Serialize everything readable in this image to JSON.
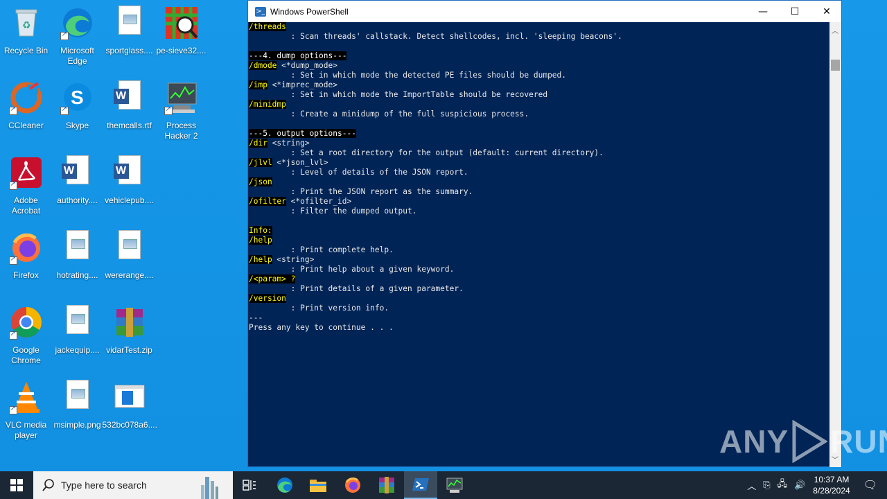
{
  "desktop": {
    "icons": [
      {
        "label": "Recycle Bin",
        "icon": "recycle-bin-icon"
      },
      {
        "label": "Microsoft Edge",
        "icon": "edge-icon"
      },
      {
        "label": "sportglass....",
        "icon": "image-file-icon"
      },
      {
        "label": "pe-sieve32....",
        "icon": "pe-sieve-icon"
      },
      {
        "label": "CCleaner",
        "icon": "ccleaner-icon"
      },
      {
        "label": "Skype",
        "icon": "skype-icon"
      },
      {
        "label": "themcalls.rtf",
        "icon": "word-doc-icon"
      },
      {
        "label": "Process Hacker 2",
        "icon": "process-hacker-icon"
      },
      {
        "label": "Adobe Acrobat",
        "icon": "acrobat-icon"
      },
      {
        "label": "authority....",
        "icon": "word-doc-icon"
      },
      {
        "label": "vehiclepub....",
        "icon": "word-doc-icon"
      },
      {
        "label": "Firefox",
        "icon": "firefox-icon"
      },
      {
        "label": "hotrating....",
        "icon": "image-file-icon"
      },
      {
        "label": "wererange....",
        "icon": "image-file-icon"
      },
      {
        "label": "Google Chrome",
        "icon": "chrome-icon"
      },
      {
        "label": "jackequip....",
        "icon": "image-file-icon"
      },
      {
        "label": "vidarTest.zip",
        "icon": "winrar-archive-icon"
      },
      {
        "label": "VLC media player",
        "icon": "vlc-icon"
      },
      {
        "label": "msimple.png",
        "icon": "image-file-icon"
      },
      {
        "label": "532bc078a6....",
        "icon": "generic-file-icon"
      }
    ]
  },
  "window": {
    "title": "Windows PowerShell",
    "minimize": "—",
    "maximize": "☐",
    "close": "✕"
  },
  "console": {
    "lines": [
      {
        "h": "/threads",
        "t": ""
      },
      {
        "h": "",
        "t": "         : Scan threads' callstack. Detect shellcodes, incl. 'sleeping beacons'."
      },
      {
        "h": "",
        "t": ""
      },
      {
        "h": "---4. dump options---",
        "t": "",
        "w": true
      },
      {
        "h": "/dmode",
        "t": " <*dump_mode>"
      },
      {
        "h": "",
        "t": "         : Set in which mode the detected PE files should be dumped."
      },
      {
        "h": "/imp",
        "t": " <*imprec_mode>"
      },
      {
        "h": "",
        "t": "         : Set in which mode the ImportTable should be recovered"
      },
      {
        "h": "/minidmp",
        "t": ""
      },
      {
        "h": "",
        "t": "         : Create a minidump of the full suspicious process."
      },
      {
        "h": "",
        "t": ""
      },
      {
        "h": "---5. output options---",
        "t": "",
        "w": true
      },
      {
        "h": "/dir",
        "t": " <string>"
      },
      {
        "h": "",
        "t": "         : Set a root directory for the output (default: current directory)."
      },
      {
        "h": "/jlvl",
        "t": " <*json_lvl>"
      },
      {
        "h": "",
        "t": "         : Level of details of the JSON report."
      },
      {
        "h": "/json",
        "t": ""
      },
      {
        "h": "",
        "t": "         : Print the JSON report as the summary."
      },
      {
        "h": "/ofilter",
        "t": " <*ofilter_id>"
      },
      {
        "h": "",
        "t": "         : Filter the dumped output."
      },
      {
        "h": "",
        "t": ""
      },
      {
        "h": "Info:",
        "t": ""
      },
      {
        "h": "/help",
        "t": ""
      },
      {
        "h": "",
        "t": "         : Print complete help."
      },
      {
        "h": "/help",
        "t": " <string>"
      },
      {
        "h": "",
        "t": "         : Print help about a given keyword."
      },
      {
        "h": "/<param> ?",
        "t": ""
      },
      {
        "h": "",
        "t": "         : Print details of a given parameter."
      },
      {
        "h": "/version",
        "t": ""
      },
      {
        "h": "",
        "t": "         : Print version info."
      },
      {
        "h": "",
        "t": "---"
      },
      {
        "h": "",
        "t": "Press any key to continue . . ."
      }
    ]
  },
  "watermark": {
    "text": "ANY",
    "text2": "RUN"
  },
  "taskbar": {
    "search_placeholder": "Type here to search",
    "apps": [
      "task-view-icon",
      "edge-icon",
      "file-explorer-icon",
      "firefox-icon",
      "winrar-icon",
      "powershell-icon",
      "process-hacker-icon"
    ],
    "time": "10:37 AM",
    "date": "8/28/2024"
  },
  "colors": {
    "console_bg": "#012456",
    "highlight": "#ffff00",
    "desktop": "#1296e6",
    "taskbar": "#1b2735"
  }
}
